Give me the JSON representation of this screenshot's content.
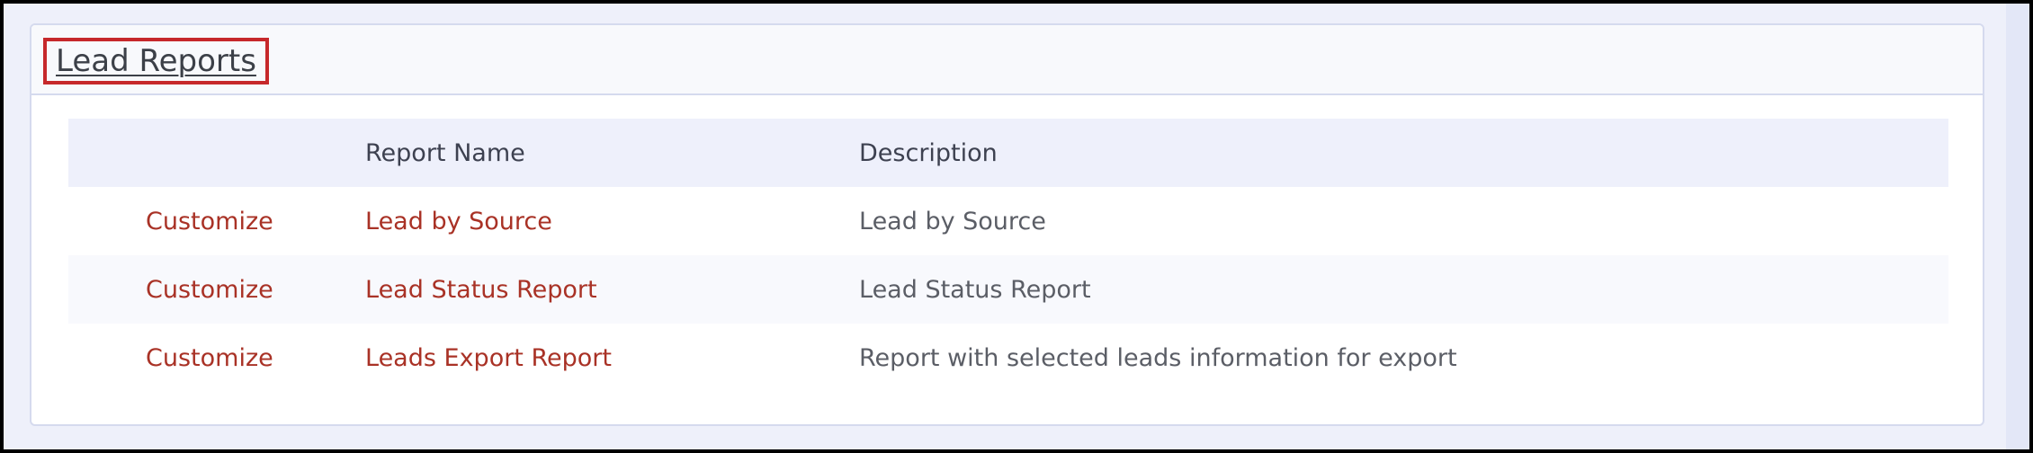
{
  "panel": {
    "title": "Lead Reports"
  },
  "table": {
    "columns": {
      "action": "",
      "name": "Report Name",
      "description": "Description"
    },
    "rows": [
      {
        "action": "Customize",
        "name": "Lead by Source",
        "description": "Lead by Source"
      },
      {
        "action": "Customize",
        "name": "Lead Status Report",
        "description": "Lead Status Report"
      },
      {
        "action": "Customize",
        "name": "Leads Export Report",
        "description": "Report with selected leads information for export"
      }
    ]
  },
  "colors": {
    "link": "#a93226",
    "highlight_border": "#c6282b",
    "header_bg": "#eef0fb"
  }
}
